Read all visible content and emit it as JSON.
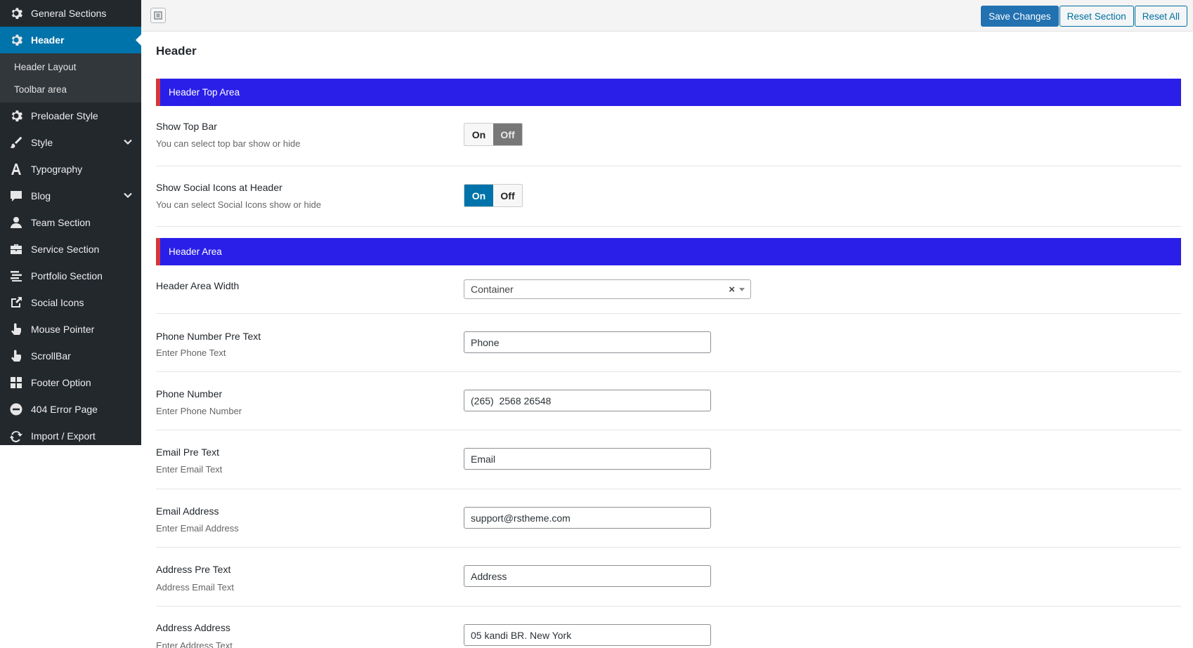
{
  "sidebar": {
    "items": [
      {
        "label": "General Sections",
        "icon": "gear-icon"
      },
      {
        "label": "Header",
        "icon": "gear-icon",
        "active": true
      },
      {
        "label": "Preloader Style",
        "icon": "gear-icon"
      },
      {
        "label": "Style",
        "icon": "brush-icon",
        "has_children": true
      },
      {
        "label": "Typography",
        "icon": "font-icon"
      },
      {
        "label": "Blog",
        "icon": "comment-icon",
        "has_children": true
      },
      {
        "label": "Team Section",
        "icon": "user-icon"
      },
      {
        "label": "Service Section",
        "icon": "briefcase-icon"
      },
      {
        "label": "Portfolio Section",
        "icon": "list-icon"
      },
      {
        "label": "Social Icons",
        "icon": "share-icon"
      },
      {
        "label": "Mouse Pointer",
        "icon": "pointer-icon"
      },
      {
        "label": "ScrollBar",
        "icon": "pointer-icon"
      },
      {
        "label": "Footer Option",
        "icon": "grid-icon"
      },
      {
        "label": "404 Error Page",
        "icon": "minus-circle-icon"
      },
      {
        "label": "Import / Export",
        "icon": "refresh-icon"
      }
    ],
    "sub_items": [
      "Header Layout",
      "Toolbar area"
    ]
  },
  "toolbar": {
    "save_label": "Save Changes",
    "reset_section_label": "Reset Section",
    "reset_all_label": "Reset All"
  },
  "page": {
    "title": "Header"
  },
  "sections": {
    "top_area": {
      "title": "Header Top Area"
    },
    "header_area": {
      "title": "Header Area"
    }
  },
  "fields": {
    "show_top_bar": {
      "label": "Show Top Bar",
      "desc": "You can select top bar show or hide",
      "on": "On",
      "off": "Off",
      "value": "off"
    },
    "show_social": {
      "label": "Show Social Icons at Header",
      "desc": "You can select Social Icons show or hide",
      "on": "On",
      "off": "Off",
      "value": "on"
    },
    "area_width": {
      "label": "Header Area Width",
      "value": "Container",
      "clear": "×"
    },
    "phone_pre": {
      "label": "Phone Number Pre Text",
      "desc": "Enter Phone Text",
      "value": "Phone"
    },
    "phone": {
      "label": "Phone Number",
      "desc": "Enter Phone Number",
      "value": "(265)  2568 26548"
    },
    "email_pre": {
      "label": "Email Pre Text",
      "desc": "Enter Email Text",
      "value": "Email"
    },
    "email": {
      "label": "Email Address",
      "desc": "Enter Email Address",
      "value": "support@rstheme.com"
    },
    "address_pre": {
      "label": "Address Pre Text",
      "desc": "Address Email Text",
      "value": "Address"
    },
    "address": {
      "label": "Address Address",
      "desc": "Enter Address Text",
      "value": "05 kandi BR. New York"
    }
  },
  "colors": {
    "sidebar_bg": "#23282d",
    "active_bg": "#0073aa",
    "section_bar": "#2a1fe8",
    "section_accent": "#d63638"
  }
}
